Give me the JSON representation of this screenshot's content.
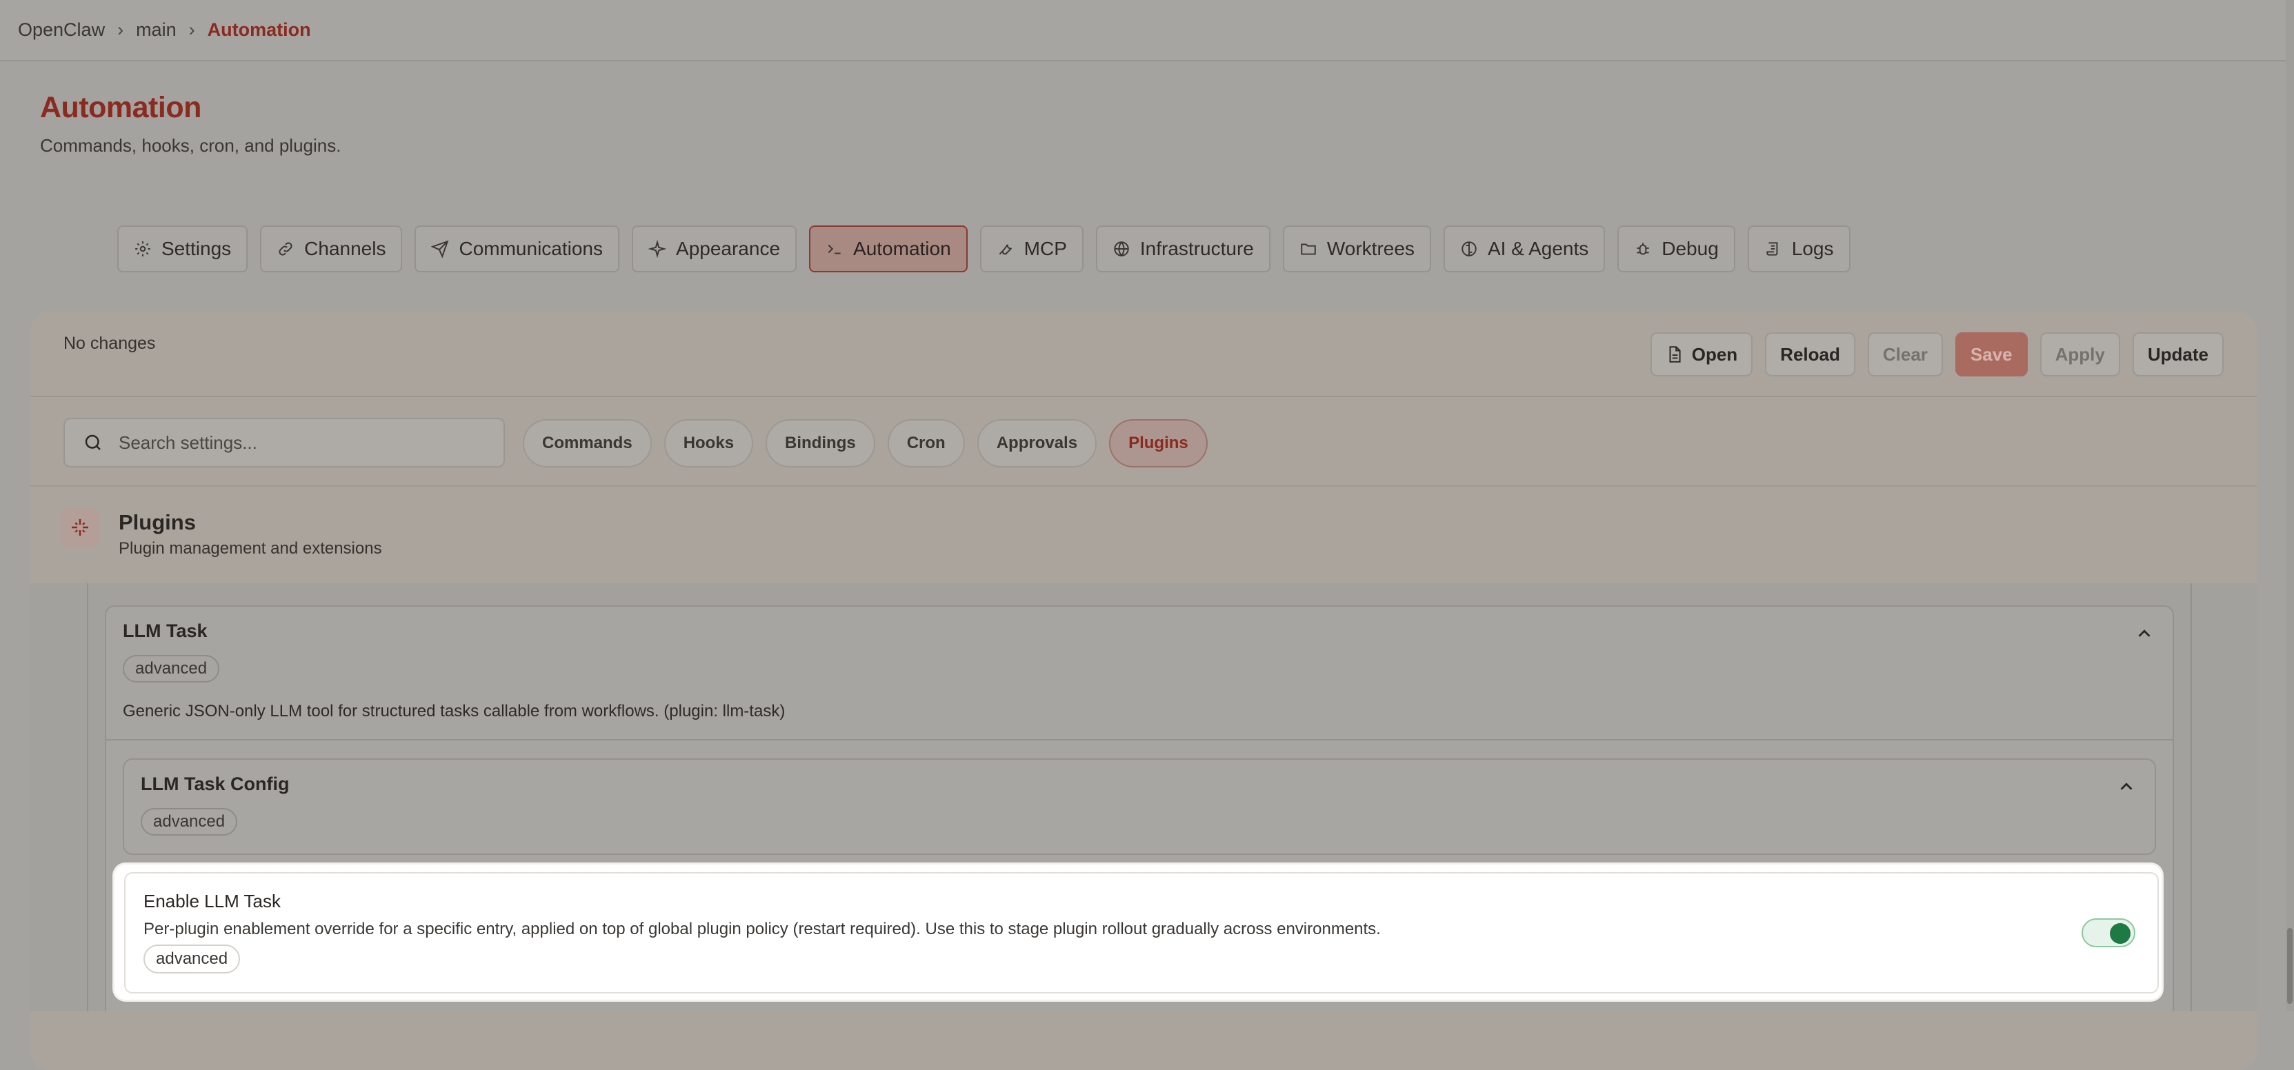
{
  "breadcrumb": {
    "root": "OpenClaw",
    "branch": "main",
    "current": "Automation",
    "separator": "›"
  },
  "header": {
    "title": "Automation",
    "subtitle": "Commands, hooks, cron, and plugins."
  },
  "tabs": [
    {
      "label": "Settings",
      "icon": "gear-icon"
    },
    {
      "label": "Channels",
      "icon": "link-icon"
    },
    {
      "label": "Communications",
      "icon": "send-icon"
    },
    {
      "label": "Appearance",
      "icon": "sparkle-icon"
    },
    {
      "label": "Automation",
      "icon": "terminal-icon",
      "active": true
    },
    {
      "label": "MCP",
      "icon": "wrench-icon"
    },
    {
      "label": "Infrastructure",
      "icon": "globe-icon"
    },
    {
      "label": "Worktrees",
      "icon": "folder-icon"
    },
    {
      "label": "AI & Agents",
      "icon": "brain-icon"
    },
    {
      "label": "Debug",
      "icon": "bug-icon"
    },
    {
      "label": "Logs",
      "icon": "scroll-icon"
    }
  ],
  "panel": {
    "status": "No changes",
    "actions": {
      "open": "Open",
      "reload": "Reload",
      "clear": "Clear",
      "save": "Save",
      "apply": "Apply",
      "update": "Update"
    },
    "search": {
      "placeholder": "Search settings..."
    },
    "filters": [
      "Commands",
      "Hooks",
      "Bindings",
      "Cron",
      "Approvals",
      "Plugins"
    ],
    "active_filter": "Plugins",
    "section": {
      "title": "Plugins",
      "subtitle": "Plugin management and extensions"
    }
  },
  "llm_task": {
    "title": "LLM Task",
    "badge": "advanced",
    "description": "Generic JSON-only LLM tool for structured tasks callable from workflows. (plugin: llm-task)",
    "config": {
      "title": "LLM Task Config",
      "badge": "advanced"
    }
  },
  "enable_field": {
    "title": "Enable LLM Task",
    "description": "Per-plugin enablement override for a specific entry, applied on top of global plugin policy (restart required). Use this to stage plugin rollout gradually across environments.",
    "badge": "advanced",
    "enabled": true
  },
  "colors": {
    "accent": "#8a2a20",
    "toggle_on": "#1e7a44"
  }
}
